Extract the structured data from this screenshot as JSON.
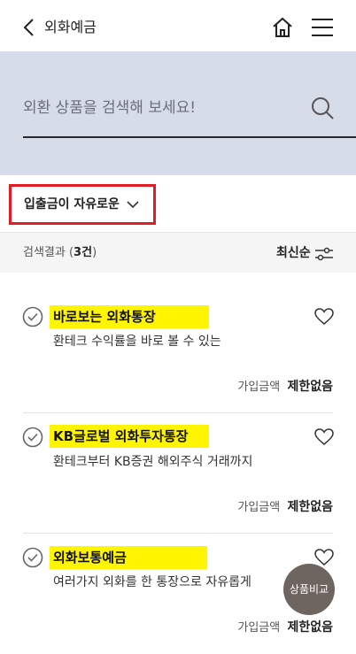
{
  "header": {
    "title": "외화예금"
  },
  "search": {
    "placeholder": "외환 상품을 검색해 보세요!"
  },
  "filter": {
    "label": "입출금이 자유로운"
  },
  "results": {
    "label": "검색결과 (",
    "count": "3건",
    "suffix": ")",
    "sort_label": "최신순"
  },
  "products": [
    {
      "name": "바로보는 외화통장",
      "desc": "환테크 수익률을 바로 볼 수 있는",
      "amount_label": "가입금액",
      "amount_value": "제한없음"
    },
    {
      "name": "KB글로벌 외화투자통장",
      "desc": "환테크부터 KB증권 해외주식 거래까지",
      "amount_label": "가입금액",
      "amount_value": "제한없음"
    },
    {
      "name": "외화보통예금",
      "desc": "여러가지 외화를 한 통장으로 자유롭게",
      "amount_label": "가입금액",
      "amount_value": "제한없음"
    }
  ],
  "compare_button": {
    "label": "상품비교"
  },
  "colors": {
    "search_bg": "#d7dce9",
    "highlight": "#fff500",
    "filter_border": "#e01d24",
    "compare_bg": "#6e6560"
  },
  "icons": [
    "back-arrow-icon",
    "home-icon",
    "menu-icon",
    "search-icon",
    "chevron-down-icon",
    "sort-filter-icon",
    "check-circle-icon",
    "heart-icon"
  ]
}
